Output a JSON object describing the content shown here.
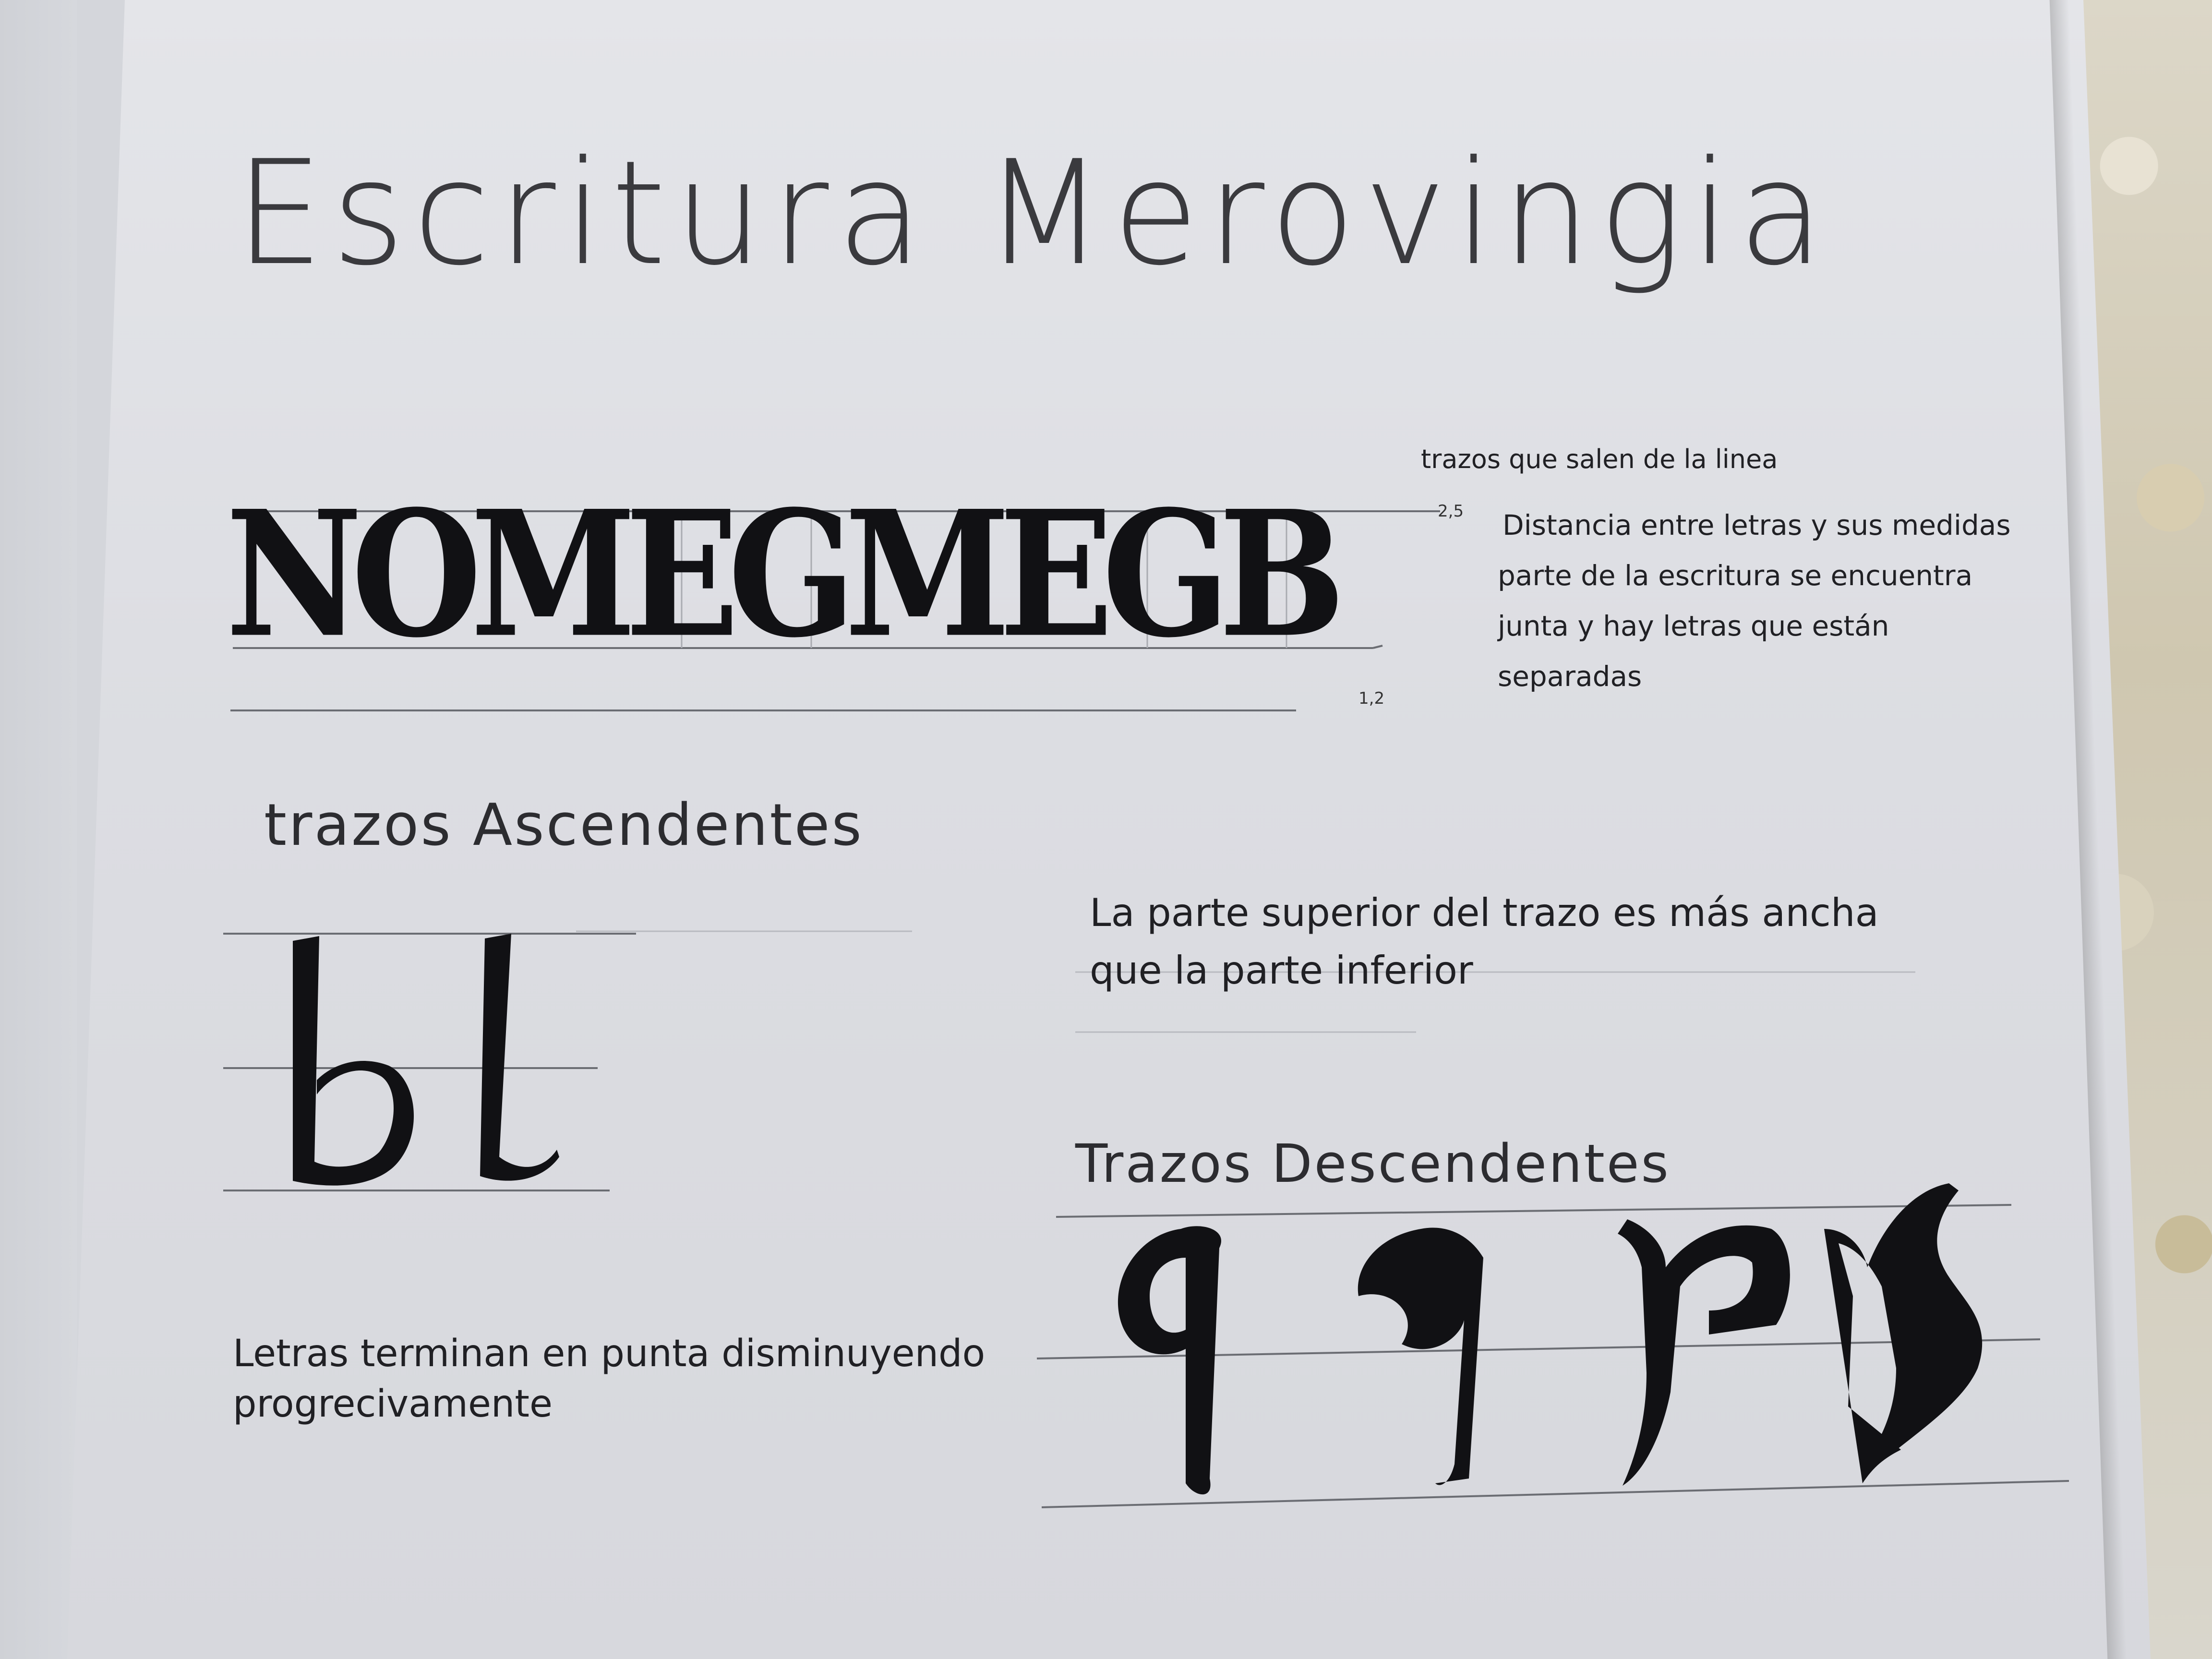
{
  "title": "Escritura Merovingia",
  "sample_word": "NOMEGMEGB",
  "measures": {
    "top": "2,5",
    "bottom": "1,2"
  },
  "notes": {
    "strokes_out": "trazos que salen de la linea",
    "spacing_1": "Distancia entre letras y sus medidas",
    "spacing_2": "parte de la escritura se encuentra",
    "spacing_3": "junta y hay letras que están",
    "spacing_4": "separadas"
  },
  "ascending": {
    "heading": "trazos Ascendentes",
    "letters": "bl",
    "note_1": "La parte superior del trazo es más ancha",
    "note_2": "que la parte inferior"
  },
  "descending": {
    "heading": "Trazos Descendentes",
    "letters": [
      "q",
      "q",
      "p",
      "n"
    ]
  },
  "ending": {
    "note_1": "Letras terminan en punta disminuyendo",
    "note_2": "progrecivamente"
  }
}
